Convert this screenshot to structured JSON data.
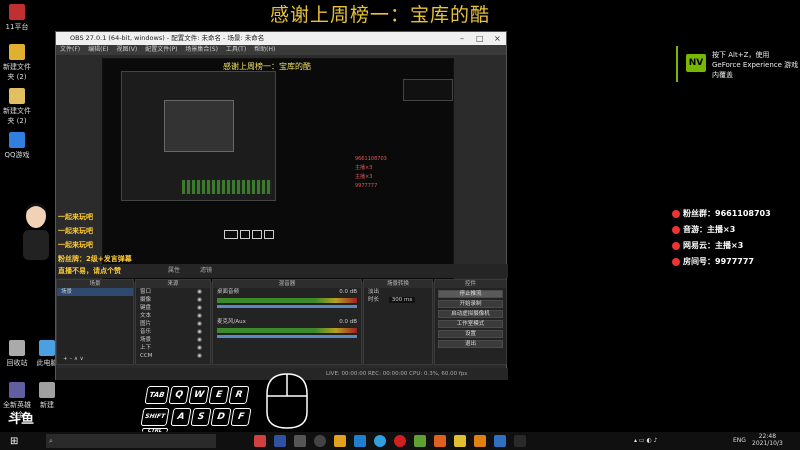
{
  "stream": {
    "banner": "感谢上周榜一：宝库的酷",
    "preview_title": "感谢上周榜一：宝库的酷"
  },
  "desktop_icons": [
    {
      "label": "11平台",
      "color": "#c03030"
    },
    {
      "label": "新建文件夹 (2)",
      "color": "#e0b030"
    },
    {
      "label": "新建文件夹 (2)",
      "color": "#e0c060"
    },
    {
      "label": "QQ游戏",
      "color": "#3080e0"
    },
    {
      "label": "回收站",
      "color": "#aaaaaa"
    },
    {
      "label": "此电脑",
      "color": "#4aa0e0"
    },
    {
      "label": "全新英雄合金",
      "color": "#6060a0"
    },
    {
      "label": "新建",
      "color": "#a0a0a0"
    }
  ],
  "notification": {
    "badge": "NV",
    "text": "按下 Alt+Z，使用 GeForce Experience 游戏内覆盖"
  },
  "obs": {
    "title": "OBS 27.0.1 (64-bit, windows) - 配置文件: 未命名 - 场景: 未命名",
    "menu": [
      "文件(F)",
      "编辑(E)",
      "视图(V)",
      "配置文件(P)",
      "场景集合(S)",
      "工具(T)",
      "帮助(H)"
    ],
    "controls_bar": [
      "属性",
      "滤镜"
    ],
    "scenes": {
      "header": "场景",
      "items": [
        "场景"
      ]
    },
    "sources": {
      "header": "来源",
      "items": [
        "窗口",
        "摄像",
        "键盘",
        "文本",
        "图片",
        "音乐",
        "场景",
        "上下",
        "CCM"
      ]
    },
    "mixer": {
      "header": "混音器",
      "tracks": [
        {
          "name": "桌面音频",
          "level": "0.0 dB"
        },
        {
          "name": "麦克风/Aux",
          "level": "0.0 dB"
        }
      ]
    },
    "transitions": {
      "header": "场景转换",
      "type": "淡出",
      "duration_label": "时长",
      "duration": "300 ms"
    },
    "controls": {
      "header": "控件",
      "buttons": [
        "停止推流",
        "开始录制",
        "启动虚拟摄像机",
        "工作室模式",
        "设置",
        "退出"
      ]
    },
    "status": "LIVE: 00:00:00   REC: 00:00:00   CPU: 0.3%, 60.00 fps"
  },
  "overlay": [
    {
      "label": "粉丝群：",
      "value": "9661108703"
    },
    {
      "label": "音游：",
      "value": "主播×3"
    },
    {
      "label": "网易云：",
      "value": "主播×3"
    },
    {
      "label": "房间号：",
      "value": "9977777"
    }
  ],
  "left_text": [
    "一起来玩吧",
    "一起来玩吧",
    "一起来玩吧",
    "粉丝牌：2级+发言弹幕",
    "直播不易，请点个赞"
  ],
  "keys": [
    "TAB",
    "Q",
    "W",
    "E",
    "R",
    "SHIFT",
    "A",
    "S",
    "D",
    "F",
    "CTRL"
  ],
  "brand": "斗鱼",
  "taskbar": {
    "search_placeholder": "",
    "lang": "ENG",
    "time": "22:48",
    "date": "2021/10/3"
  },
  "colors": {
    "accent": "#e8c23a",
    "nvidia": "#76b900",
    "live": "#e33333"
  }
}
